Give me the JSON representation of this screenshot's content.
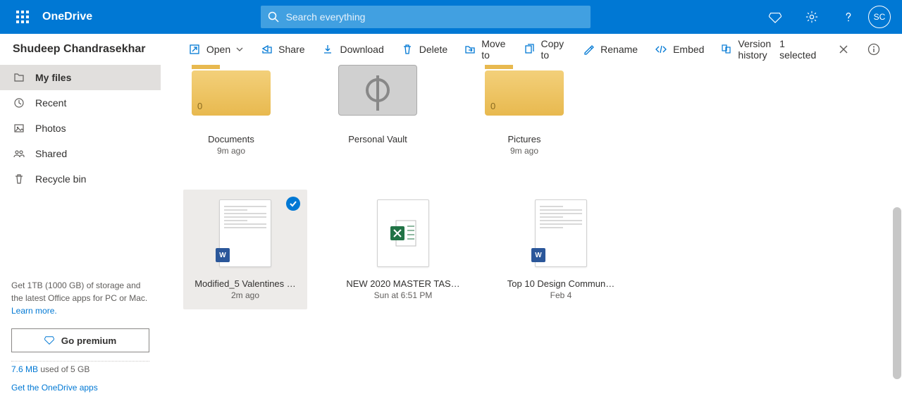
{
  "app": {
    "name": "OneDrive"
  },
  "search": {
    "placeholder": "Search everything"
  },
  "avatar": {
    "initials": "SC"
  },
  "breadcrumb": {
    "owner": "Shudeep Chandrasekhar"
  },
  "commands": {
    "open": "Open",
    "share": "Share",
    "download": "Download",
    "delete": "Delete",
    "move_to": "Move to",
    "copy_to": "Copy to",
    "rename": "Rename",
    "embed": "Embed",
    "version_history": "Version history"
  },
  "selection": {
    "label": "1 selected"
  },
  "nav": {
    "items": [
      {
        "label": "My files"
      },
      {
        "label": "Recent"
      },
      {
        "label": "Photos"
      },
      {
        "label": "Shared"
      },
      {
        "label": "Recycle bin"
      }
    ]
  },
  "promo": {
    "text": "Get 1TB (1000 GB) of storage and the latest Office apps for PC or Mac.",
    "link": "Learn more."
  },
  "premium_button": "Go premium",
  "storage": {
    "used": "7.6 MB",
    "rest": " used of 5 GB"
  },
  "get_apps": "Get the OneDrive apps",
  "folders": [
    {
      "name": "Documents",
      "sub": "9m ago",
      "count": "0",
      "type": "folder"
    },
    {
      "name": "Personal Vault",
      "sub": "",
      "count": "",
      "type": "vault"
    },
    {
      "name": "Pictures",
      "sub": "9m ago",
      "count": "0",
      "type": "folder"
    }
  ],
  "files": [
    {
      "name": "Modified_5 Valentines …",
      "sub": "2m ago",
      "type": "word",
      "selected": true
    },
    {
      "name": "NEW 2020 MASTER TAS…",
      "sub": "Sun at 6:51 PM",
      "type": "excel",
      "selected": false
    },
    {
      "name": "Top 10 Design Commun…",
      "sub": "Feb 4",
      "type": "word",
      "selected": false
    }
  ],
  "colors": {
    "brand": "#0078d4"
  }
}
